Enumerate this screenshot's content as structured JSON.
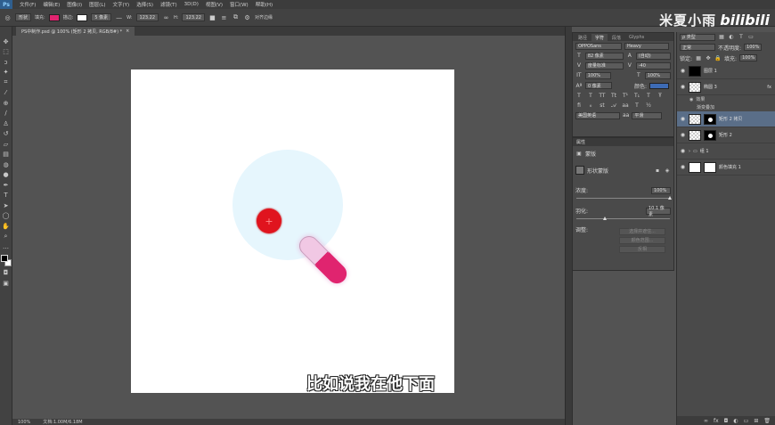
{
  "app": {
    "logo": "Ps"
  },
  "menu": [
    "文件(F)",
    "编辑(E)",
    "图像(I)",
    "图层(L)",
    "文字(Y)",
    "选择(S)",
    "滤镜(T)",
    "3D(D)",
    "视图(V)",
    "窗口(W)",
    "帮助(H)"
  ],
  "options": {
    "shape_mode": "形状",
    "fill_label": "填充:",
    "fill_color": "#e0246f",
    "stroke_label": "描边:",
    "stroke_width": "5 像素",
    "w_label": "W:",
    "w_value": "123.22",
    "h_label": "H:",
    "h_value": "123.22",
    "align_edges": "对齐边缘"
  },
  "watermark": {
    "name": "米夏小雨",
    "logo": "bilibili"
  },
  "document": {
    "tab_title": "PS中制作.psd @ 100% (矩形 2 拷贝, RGB/8#) *",
    "close": "×"
  },
  "canvas": {
    "background": "#ffffff",
    "glow_color": "#e6f6fd",
    "red_dot_color": "#e0141e",
    "handle_color": "#e0246f",
    "handle_light": "#f1c8e4"
  },
  "subtitle": "比如说我在他下面",
  "status": {
    "zoom": "100%",
    "doc_info": "文档:1.00M/6.18M"
  },
  "character_panel": {
    "tabs": [
      "路径",
      "字符",
      "段落",
      "Glyphs"
    ],
    "font_family": "OPPOSans",
    "font_style": "Heavy",
    "size": "82 像素",
    "leading": "(自动)",
    "kerning": "度量标准",
    "tracking": "-40",
    "vscale": "100%",
    "hscale": "100%",
    "baseline": "0 像素",
    "color_label": "颜色:",
    "color": "#3d6bb5",
    "language": "美国英语",
    "aa_label": "aa",
    "aa_mode": "平滑"
  },
  "properties_panel": {
    "title": "属性",
    "section": "蒙版",
    "mask_label": "形状蒙版",
    "density_label": "浓度:",
    "density_value": "100%",
    "density_level": 1.0,
    "feather_label": "羽化:",
    "feather_value": "10.1 像素",
    "feather_level": 0.3,
    "refine_label": "调整:",
    "btn_select_mask": "选择并遮住...",
    "btn_color_range": "颜色范围...",
    "btn_invert": "反相"
  },
  "layers_panel": {
    "filter": "ρ 类型",
    "blend": "正常",
    "opacity_label": "不透明度:",
    "opacity": "100%",
    "lock_label": "锁定:",
    "fill_label": "填充:",
    "fill": "100%",
    "layers": [
      {
        "name": "图层 1",
        "thumb": "black"
      },
      {
        "name": "椭圆 3",
        "thumb": "checker",
        "fx": "fx"
      },
      {
        "name": "矩形 2 拷贝",
        "thumb": "mask",
        "selected": true
      },
      {
        "name": "矩形 2",
        "thumb": "mask"
      },
      {
        "name": "组 1",
        "thumb": "folder"
      },
      {
        "name": "颜色填充 1",
        "thumb": "white"
      }
    ],
    "effects_label": "效果",
    "effect_item": "渐变叠加"
  }
}
